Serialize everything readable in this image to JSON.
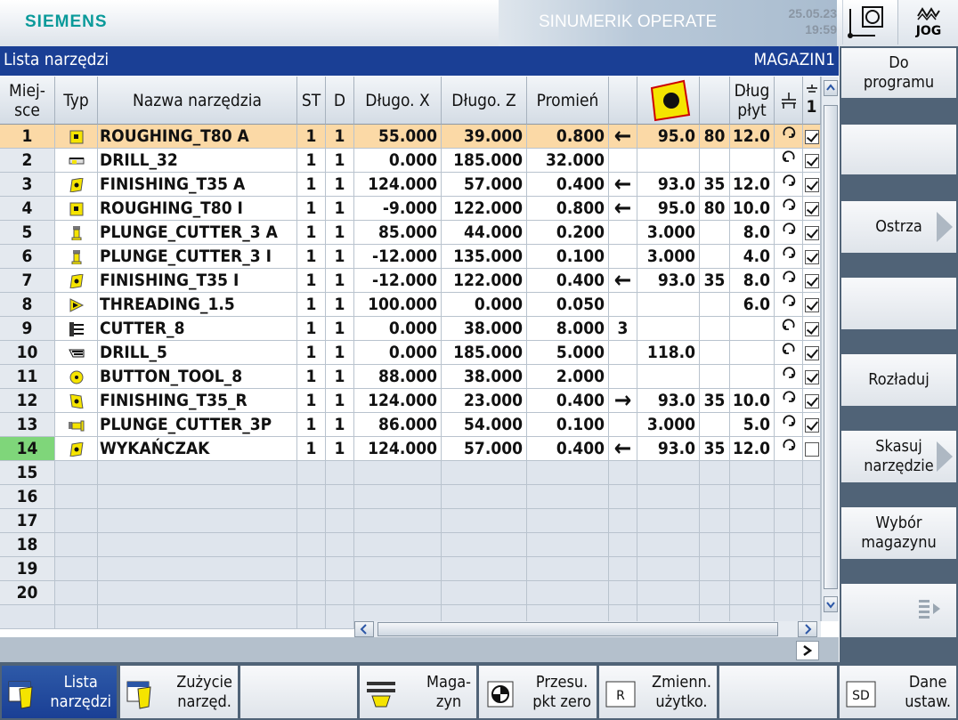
{
  "header": {
    "brand": "SIEMENS",
    "product": "SINUMERIK OPERATE",
    "date": "25.05.23",
    "time": "19:59",
    "mode": "JOG"
  },
  "titlebar": {
    "title": "Lista narzędzi",
    "magazine": "MAGAZIN1"
  },
  "columns": {
    "place": "Miej-\nsce",
    "type": "Typ",
    "name": "Nazwa narzędzia",
    "st": "ST",
    "d": "D",
    "length_x": "Długo. X",
    "length_z": "Długo. Z",
    "radius": "Promień",
    "plate_length": "Dług\npłyt",
    "col_last": "1"
  },
  "rows": [
    {
      "place": "1",
      "type_icon": "roughing-insert-icon",
      "name": "ROUGHING_T80 A",
      "st": "1",
      "d": "1",
      "lx": "55.000",
      "lz": "39.000",
      "r": "0.800",
      "dir": "←",
      "angle": "95.0",
      "angle2": "80",
      "plate": "12.0",
      "spindle": "cw",
      "enabled": true,
      "selected": true
    },
    {
      "place": "2",
      "type_icon": "drill-icon",
      "name": "DRILL_32",
      "st": "1",
      "d": "1",
      "lx": "0.000",
      "lz": "185.000",
      "r": "32.000",
      "dir": "",
      "angle": "",
      "angle2": "",
      "plate": "",
      "spindle": "ccw",
      "enabled": true
    },
    {
      "place": "3",
      "type_icon": "finishing-insert-icon",
      "name": "FINISHING_T35 A",
      "st": "1",
      "d": "1",
      "lx": "124.000",
      "lz": "57.000",
      "r": "0.400",
      "dir": "←",
      "angle": "93.0",
      "angle2": "35",
      "plate": "12.0",
      "spindle": "cw",
      "enabled": true
    },
    {
      "place": "4",
      "type_icon": "roughing-insert-icon",
      "name": "ROUGHING_T80 I",
      "st": "1",
      "d": "1",
      "lx": "-9.000",
      "lz": "122.000",
      "r": "0.800",
      "dir": "←",
      "angle": "95.0",
      "angle2": "80",
      "plate": "10.0",
      "spindle": "cw",
      "enabled": true
    },
    {
      "place": "5",
      "type_icon": "plunge-cutter-icon",
      "name": "PLUNGE_CUTTER_3 A",
      "st": "1",
      "d": "1",
      "lx": "85.000",
      "lz": "44.000",
      "r": "0.200",
      "dir": "",
      "angle": "3.000",
      "angle2": "",
      "plate": "8.0",
      "spindle": "cw",
      "enabled": true
    },
    {
      "place": "6",
      "type_icon": "plunge-cutter-icon",
      "name": "PLUNGE_CUTTER_3 I",
      "st": "1",
      "d": "1",
      "lx": "-12.000",
      "lz": "135.000",
      "r": "0.100",
      "dir": "",
      "angle": "3.000",
      "angle2": "",
      "plate": "4.0",
      "spindle": "cw",
      "enabled": true
    },
    {
      "place": "7",
      "type_icon": "finishing-insert-icon",
      "name": "FINISHING_T35 I",
      "st": "1",
      "d": "1",
      "lx": "-12.000",
      "lz": "122.000",
      "r": "0.400",
      "dir": "←",
      "angle": "93.0",
      "angle2": "35",
      "plate": "8.0",
      "spindle": "cw",
      "enabled": true
    },
    {
      "place": "8",
      "type_icon": "threading-icon",
      "name": "THREADING_1.5",
      "st": "1",
      "d": "1",
      "lx": "100.000",
      "lz": "0.000",
      "r": "0.050",
      "dir": "",
      "angle": "",
      "angle2": "",
      "plate": "6.0",
      "spindle": "cw",
      "enabled": true
    },
    {
      "place": "9",
      "type_icon": "cutter-icon",
      "name": "CUTTER_8",
      "st": "1",
      "d": "1",
      "lx": "0.000",
      "lz": "38.000",
      "r": "8.000",
      "dir": "3",
      "angle": "",
      "angle2": "",
      "plate": "",
      "spindle": "ccw",
      "enabled": true
    },
    {
      "place": "10",
      "type_icon": "drill-small-icon",
      "name": "DRILL_5",
      "st": "1",
      "d": "1",
      "lx": "0.000",
      "lz": "185.000",
      "r": "5.000",
      "dir": "",
      "angle": "118.0",
      "angle2": "",
      "plate": "",
      "spindle": "ccw",
      "enabled": true
    },
    {
      "place": "11",
      "type_icon": "button-tool-icon",
      "name": "BUTTON_TOOL_8",
      "st": "1",
      "d": "1",
      "lx": "88.000",
      "lz": "38.000",
      "r": "2.000",
      "dir": "",
      "angle": "",
      "angle2": "",
      "plate": "",
      "spindle": "cw",
      "enabled": true
    },
    {
      "place": "12",
      "type_icon": "finishing-insert-right-icon",
      "name": "FINISHING_T35_R",
      "st": "1",
      "d": "1",
      "lx": "124.000",
      "lz": "23.000",
      "r": "0.400",
      "dir": "→",
      "angle": "93.0",
      "angle2": "35",
      "plate": "10.0",
      "spindle": "cw",
      "enabled": true
    },
    {
      "place": "13",
      "type_icon": "plunge-cutter-p-icon",
      "name": "PLUNGE_CUTTER_3P",
      "st": "1",
      "d": "1",
      "lx": "86.000",
      "lz": "54.000",
      "r": "0.100",
      "dir": "",
      "angle": "3.000",
      "angle2": "",
      "plate": "5.0",
      "spindle": "cw",
      "enabled": true
    },
    {
      "place": "14",
      "type_icon": "finishing-insert-icon",
      "name": "WYKAŃCZAK",
      "st": "1",
      "d": "1",
      "lx": "124.000",
      "lz": "57.000",
      "r": "0.400",
      "dir": "←",
      "angle": "93.0",
      "angle2": "35",
      "plate": "12.0",
      "spindle": "cw",
      "enabled": false,
      "active_place": true
    }
  ],
  "empty_places": [
    "15",
    "16",
    "17",
    "18",
    "19",
    "20"
  ],
  "right_softkeys": [
    {
      "label": "Do\nprogramu",
      "arrow": false
    },
    {
      "label": "",
      "arrow": false
    },
    {
      "label": "Ostrza",
      "arrow": true
    },
    {
      "label": "",
      "arrow": false
    },
    {
      "label": "Rozładuj",
      "arrow": false
    },
    {
      "label": "Skasuj\nnarzędzie",
      "arrow": true
    },
    {
      "label": "Wybór\nmagazynu",
      "arrow": false
    },
    {
      "label": "",
      "arrow": false,
      "more": true
    }
  ],
  "bottom_softkeys": [
    {
      "label": "Lista\nnarzędzi",
      "icon": "tool-list-icon",
      "active": true
    },
    {
      "label": "Zużycie\nnarzęd.",
      "icon": "tool-wear-icon",
      "active": false
    },
    {
      "label": "",
      "icon": "",
      "active": false
    },
    {
      "label": "Maga-\nzyn",
      "icon": "magazine-icon",
      "active": false
    },
    {
      "label": "Przesu.\npkt zero",
      "icon": "zero-offset-icon",
      "active": false
    },
    {
      "label": "Zmienn.\nużytko.",
      "icon": "user-variables-icon",
      "active": false,
      "icon_text": "R"
    },
    {
      "label": "",
      "icon": "",
      "active": false
    },
    {
      "label": "Dane\nustaw.",
      "icon": "setting-data-icon",
      "active": false,
      "icon_text": "SD"
    }
  ],
  "colors": {
    "title_blue": "#1a3f95",
    "selection": "#fbd9a6",
    "active_place": "#7fd67a",
    "tool_yellow": "#f5e400",
    "softkey_frame": "#506377"
  }
}
